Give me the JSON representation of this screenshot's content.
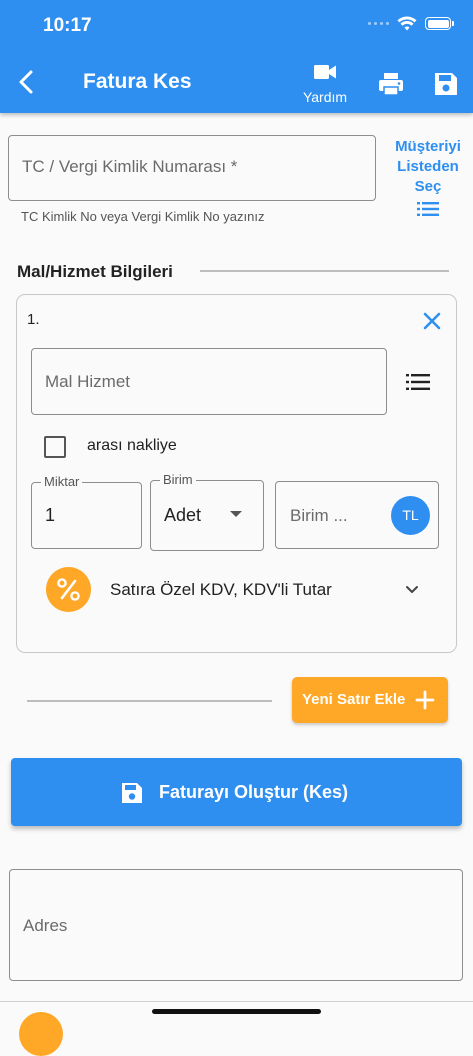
{
  "status_bar": {
    "time": "10:17"
  },
  "appbar": {
    "title": "Fatura Kes",
    "help_label": "Yardım"
  },
  "customer": {
    "tc_placeholder": "TC / Vergi Kimlik Numarası *",
    "helper_text": "TC Kimlik No veya Vergi Kimlik No yazınız",
    "select_from_list_label": [
      "Müşteriyi",
      "Listeden",
      "Seç"
    ]
  },
  "items_section": {
    "title": "Mal/Hizmet Bilgileri",
    "rows": [
      {
        "number": "1.",
        "product_placeholder": "Mal Hizmet",
        "checkbox_label": "arası nakliye",
        "quantity_label": "Miktar",
        "quantity_value": "1",
        "unit_label": "Birim",
        "unit_value": "Adet",
        "unit_price_placeholder": "Birim ...",
        "currency": "TL",
        "vat_label": "Satıra Özel KDV, KDV'li Tutar"
      }
    ],
    "add_row_label": "Yeni Satır Ekle"
  },
  "create_button_label": "Faturayı Oluştur (Kes)",
  "address_placeholder": "Adres",
  "colors": {
    "primary": "#2f8ff0",
    "accent": "#ffa726",
    "background": "#fafafa"
  }
}
